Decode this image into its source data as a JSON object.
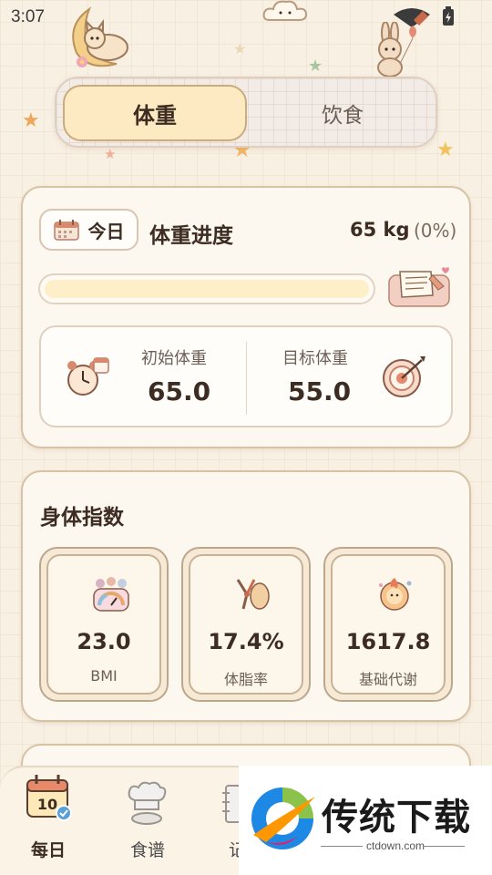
{
  "status_bar": {
    "time": "3:07"
  },
  "tabs": {
    "active": "体重",
    "inactive": "饮食"
  },
  "progress": {
    "today_label": "今日",
    "title": "体重进度",
    "weight": "65 kg",
    "percent": "(0%)",
    "fill_fraction": 0
  },
  "weights": {
    "initial_label": "初始体重",
    "initial_value": "65.0",
    "target_label": "目标体重",
    "target_value": "55.0"
  },
  "body_index": {
    "title": "身体指数",
    "metrics": [
      {
        "value": "23.0",
        "label": "BMI"
      },
      {
        "value": "17.4%",
        "label": "体脂率"
      },
      {
        "value": "1617.8",
        "label": "基础代谢"
      }
    ]
  },
  "nav": {
    "items": [
      {
        "label": "每日",
        "badge": "10"
      },
      {
        "label": "食谱"
      },
      {
        "label": "记"
      }
    ]
  },
  "watermark": {
    "brand": "传统下载",
    "site": "ctdown.com"
  },
  "colors": {
    "accent": "#fde9c2",
    "card_border": "#d8c2a3",
    "text": "#3d2c22"
  }
}
